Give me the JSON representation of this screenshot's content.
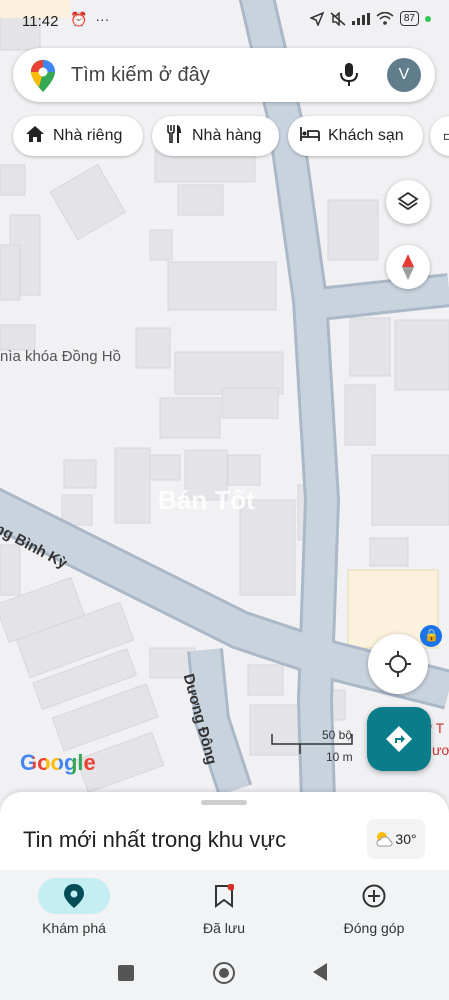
{
  "status_bar": {
    "time": "11:42",
    "left_icons": [
      "alarm-icon",
      "more-icon"
    ],
    "right_icons": [
      "location-arrow-icon",
      "mute-icon",
      "signal-icon",
      "wifi-icon"
    ],
    "battery": "87"
  },
  "search": {
    "placeholder": "Tìm kiếm ở đây",
    "avatar_letter": "V"
  },
  "chips": [
    {
      "label": "Nhà riêng",
      "icon": "home-icon"
    },
    {
      "label": "Nhà hàng",
      "icon": "restaurant-icon"
    },
    {
      "label": "Khách sạn",
      "icon": "bed-icon"
    }
  ],
  "map": {
    "place_label": "nìa khóa Đồng Hồ",
    "street_1": "ng Bình Kỳ",
    "street_2": "Dương Đông",
    "partial_label": "y T",
    "partial_label_2": "ươ",
    "watermark": "Bán Tốt",
    "scale_feet": "50 bộ",
    "scale_meters": "10 m",
    "logo": "Google"
  },
  "sheet": {
    "title": "Tin mới nhất trong khu vực",
    "temperature": "30°"
  },
  "bottom_nav": [
    {
      "label": "Khám phá",
      "icon": "explore-pin-icon",
      "active": true
    },
    {
      "label": "Đã lưu",
      "icon": "bookmark-icon",
      "active": false
    },
    {
      "label": "Đóng góp",
      "icon": "add-circle-icon",
      "active": false
    }
  ],
  "colors": {
    "accent": "#0b7c8a",
    "active_pill": "#c4eef4",
    "road": "#aab8c8",
    "building": "#e4e4e8",
    "map_bg": "#f1f1f3"
  }
}
